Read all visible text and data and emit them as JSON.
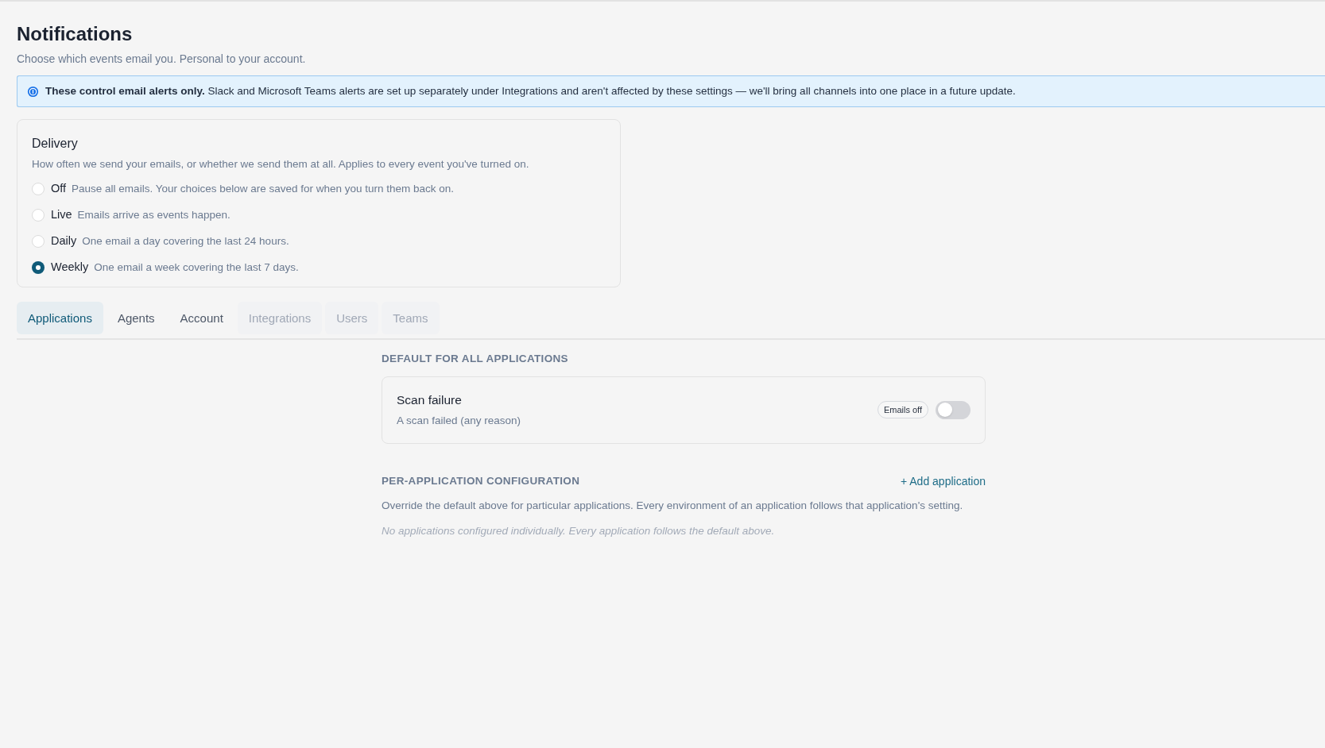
{
  "header": {
    "title": "Notifications",
    "subtitle": "Choose which events email you. Personal to your account."
  },
  "banner": {
    "text": "**These control email alerts only.** Slack and Microsoft Teams alerts are set up separately under Integrations and aren't affected by these settings — we'll bring all channels into one place in a future update."
  },
  "delivery": {
    "title": "Delivery",
    "description": "How often we send your emails, or whether we send them at all. Applies to every event you've turned on.",
    "options": [
      {
        "label": "Off",
        "description": "Pause all emails. Your choices below are saved for when you turn them back on.",
        "selected": false
      },
      {
        "label": "Live",
        "description": "Emails arrive as events happen.",
        "selected": false
      },
      {
        "label": "Daily",
        "description": "One email a day covering the last 24 hours.",
        "selected": false
      },
      {
        "label": "Weekly",
        "description": "One email a week covering the last 7 days.",
        "selected": true
      }
    ]
  },
  "tabs": [
    {
      "label": "Applications",
      "selected": true,
      "disabled": false
    },
    {
      "label": "Agents",
      "selected": false,
      "disabled": false
    },
    {
      "label": "Account",
      "selected": false,
      "disabled": false
    },
    {
      "label": "Integrations",
      "selected": false,
      "disabled": true
    },
    {
      "label": "Users",
      "selected": false,
      "disabled": true
    },
    {
      "label": "Teams",
      "selected": false,
      "disabled": true
    }
  ],
  "default_section": {
    "heading": "DEFAULT FOR ALL APPLICATIONS",
    "events": [
      {
        "title": "Scan failure",
        "description": "A scan failed (any reason)",
        "badge": "Emails off",
        "on": false
      }
    ]
  },
  "per_application": {
    "heading": "PER-APPLICATION CONFIGURATION",
    "action": "+ Add application",
    "description": "Override the default above for particular applications. Every environment of an application follows that application's setting.",
    "empty_text": "No applications configured individually. Every application follows the default above."
  }
}
